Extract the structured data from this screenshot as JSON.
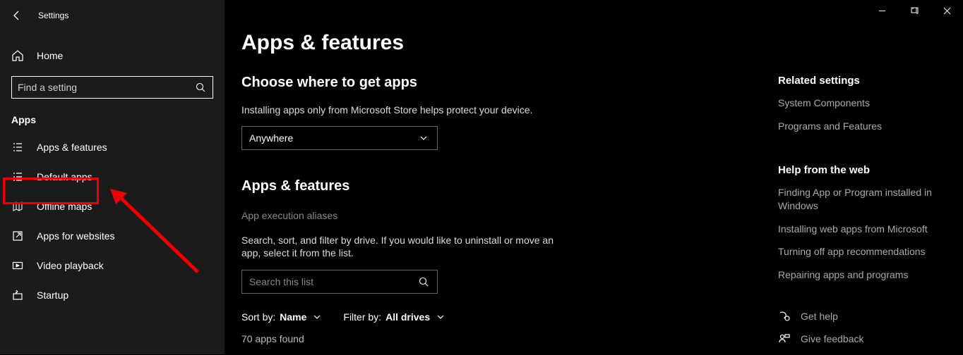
{
  "window": {
    "title": "Settings"
  },
  "sidebar": {
    "home": "Home",
    "search_placeholder": "Find a setting",
    "section": "Apps",
    "items": [
      {
        "label": "Apps & features"
      },
      {
        "label": "Default apps"
      },
      {
        "label": "Offline maps"
      },
      {
        "label": "Apps for websites"
      },
      {
        "label": "Video playback"
      },
      {
        "label": "Startup"
      }
    ]
  },
  "main": {
    "title": "Apps & features",
    "section1": {
      "heading": "Choose where to get apps",
      "desc": "Installing apps only from Microsoft Store helps protect your device.",
      "dropdown_value": "Anywhere"
    },
    "section2": {
      "heading": "Apps & features",
      "aliases_link": "App execution aliases",
      "desc": "Search, sort, and filter by drive. If you would like to uninstall or move an app, select it from the list.",
      "search_placeholder": "Search this list",
      "sort_label": "Sort by:",
      "sort_value": "Name",
      "filter_label": "Filter by:",
      "filter_value": "All drives",
      "count": "70 apps found"
    }
  },
  "right": {
    "related_title": "Related settings",
    "related_links": [
      "System Components",
      "Programs and Features"
    ],
    "help_title": "Help from the web",
    "help_links": [
      "Finding App or Program installed in Windows",
      "Installing web apps from Microsoft",
      "Turning off app recommendations",
      "Repairing apps and programs"
    ],
    "get_help": "Get help",
    "give_feedback": "Give feedback"
  }
}
